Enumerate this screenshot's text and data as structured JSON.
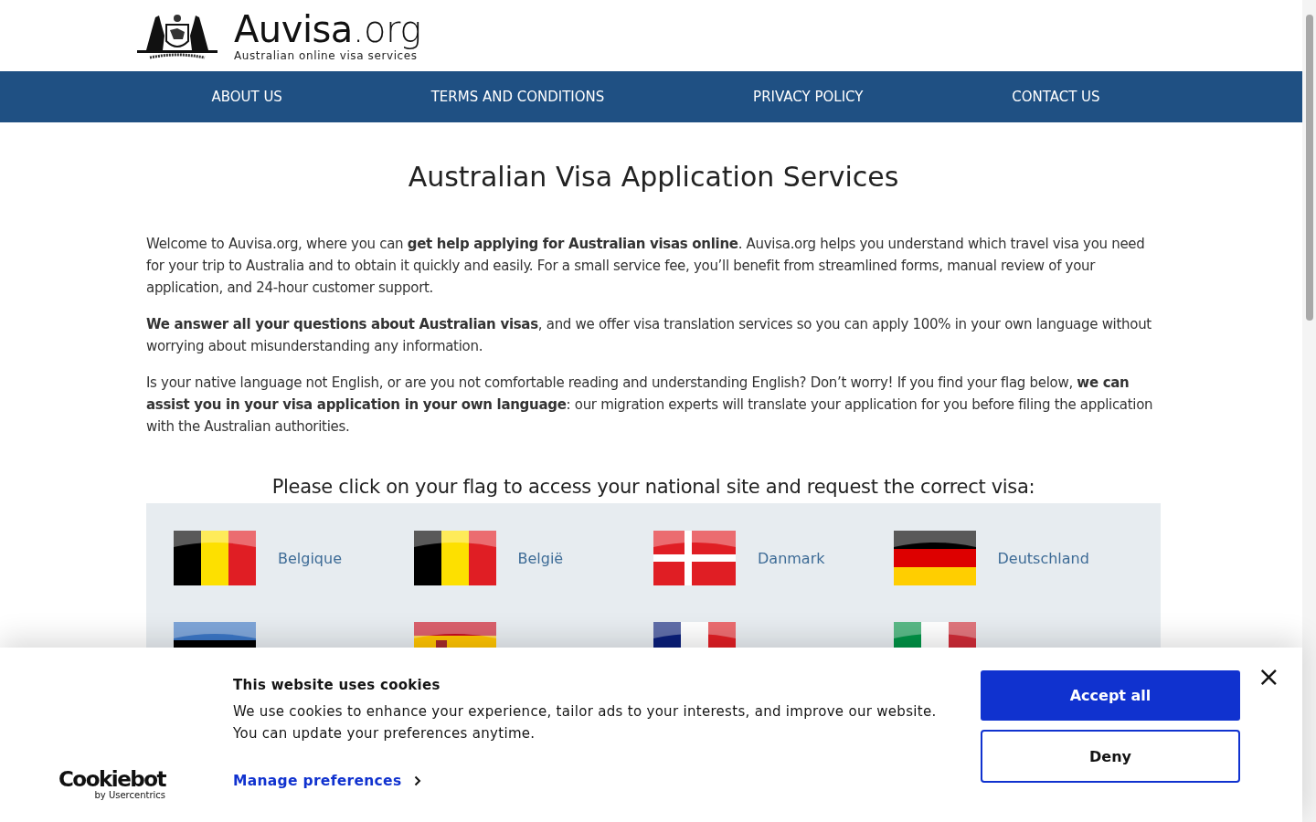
{
  "header": {
    "logo_name": "Auvisa",
    "logo_tld": ".org",
    "tagline": "Australian online visa services"
  },
  "nav": [
    "ABOUT US",
    "TERMS AND CONDITIONS",
    "PRIVACY POLICY",
    "CONTACT US"
  ],
  "title": "Australian Visa Application Services",
  "paragraphs": [
    "Welcome to Auvisa.org, where you can **get help applying for Australian visas online**. Auvisa.org helps you understand which travel visa you need for your trip to Australia and to obtain it quickly and easily. For a small service fee, you’ll benefit from streamlined forms, manual review of your application, and 24-hour customer support.",
    "**We answer all your questions about Australian visas**, and we offer visa translation services so you can apply 100% in your own language without worrying about misunderstanding any information.",
    "Is your native language not English, or are you not comfortable reading and understanding English? Don’t worry! If you find your flag below, **we can assist you in your visa application in your own language**: our migration experts will translate your application for you before filing the application with the Australian authorities."
  ],
  "flags_heading": "Please click on your flag to access your national site and request the correct visa:",
  "flags": [
    {
      "label": "Belgique",
      "kind": "belgium"
    },
    {
      "label": "België",
      "kind": "belgium"
    },
    {
      "label": "Danmark",
      "kind": "denmark"
    },
    {
      "label": "Deutschland",
      "kind": "germany"
    },
    {
      "kind": "estonia"
    },
    {
      "kind": "spain"
    },
    {
      "kind": "france"
    },
    {
      "kind": "italy"
    }
  ],
  "cookie_banner": {
    "brand": "Cookiebot",
    "brand_sub": "by Usercentrics",
    "title": "This website uses cookies",
    "text": "We use cookies to enhance your experience, tailor ads to your interests, and improve our website. You can update your preferences anytime.",
    "manage": "Manage preferences",
    "accept": "Accept all",
    "deny": "Deny",
    "close": "×"
  }
}
